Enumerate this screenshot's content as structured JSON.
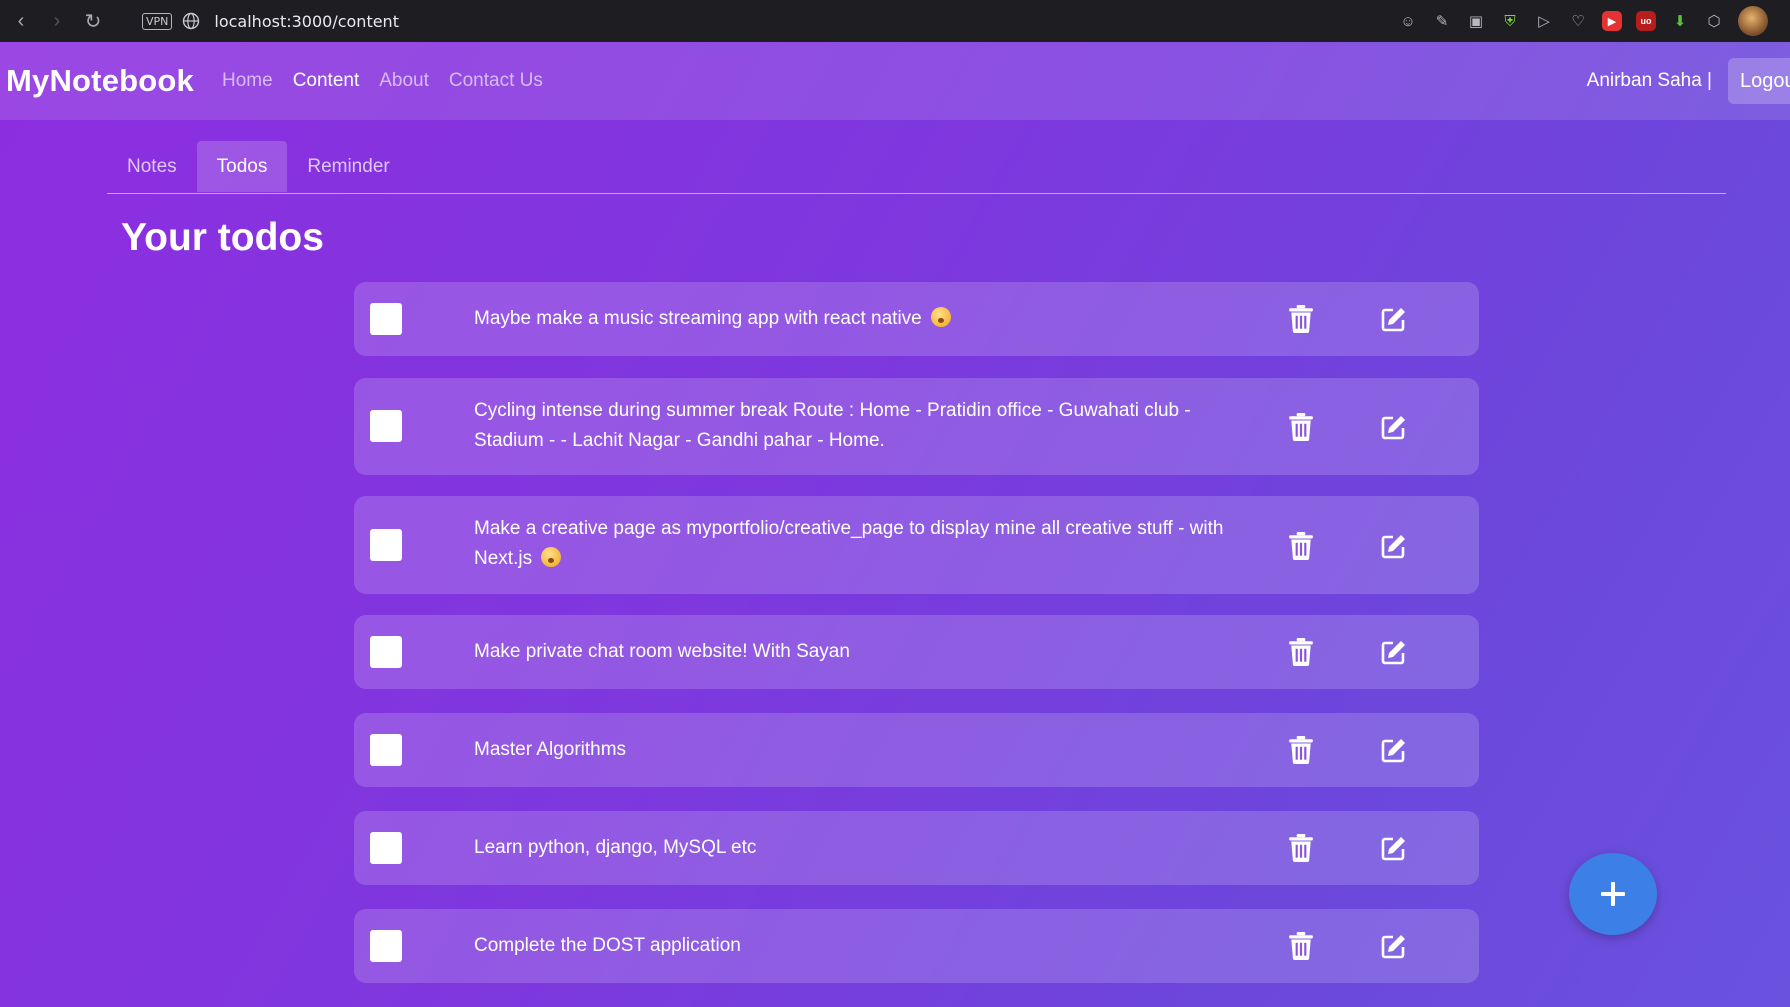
{
  "browser": {
    "url": "localhost:3000/content",
    "vpn_label": "VPN"
  },
  "navbar": {
    "brand": "MyNotebook",
    "links": [
      {
        "label": "Home",
        "active": false
      },
      {
        "label": "Content",
        "active": true
      },
      {
        "label": "About",
        "active": false
      },
      {
        "label": "Contact Us",
        "active": false
      }
    ],
    "user_name": "Anirban Saha |",
    "logout_label": "Logout"
  },
  "tabs": [
    {
      "label": "Notes",
      "active": false
    },
    {
      "label": "Todos",
      "active": true
    },
    {
      "label": "Reminder",
      "active": false
    }
  ],
  "heading": "Your todos",
  "todos": [
    {
      "text": "Maybe make a music streaming app with react native",
      "emoji": true,
      "checked": false
    },
    {
      "text": "Cycling intense during summer break Route : Home - Pratidin office - Guwahati club - Stadium - - Lachit Nagar - Gandhi pahar - Home.",
      "emoji": false,
      "checked": false
    },
    {
      "text": "Make a creative page as myportfolio/creative_page to display mine all creative stuff - with Next.js",
      "emoji": true,
      "checked": false
    },
    {
      "text": "Make private chat room website! With Sayan",
      "emoji": false,
      "checked": false
    },
    {
      "text": "Master Algorithms",
      "emoji": false,
      "checked": false
    },
    {
      "text": "Learn python, django, MySQL etc",
      "emoji": false,
      "checked": false
    },
    {
      "text": "Complete the DOST application",
      "emoji": false,
      "checked": false
    }
  ],
  "icons": {
    "delete": "trash-icon",
    "edit": "edit-icon",
    "add": "plus-icon"
  },
  "colors": {
    "fab": "#3c7fe6",
    "bg_start": "#8d2ee0",
    "bg_end": "#6a52df"
  }
}
